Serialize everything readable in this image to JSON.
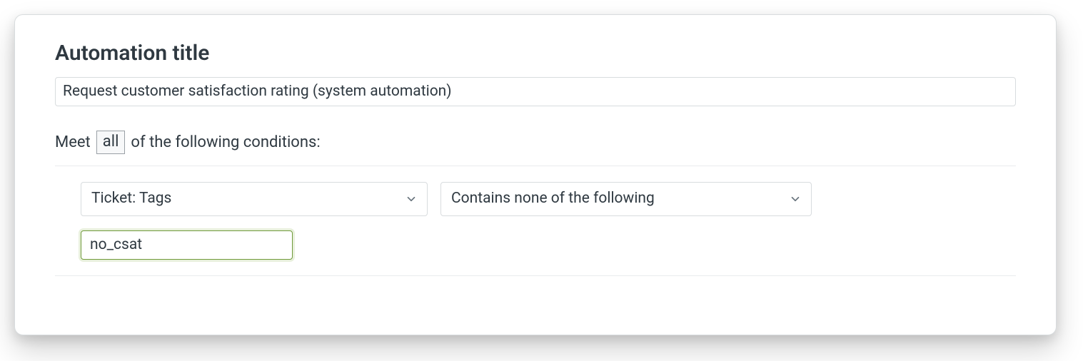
{
  "heading": "Automation title",
  "title_field": {
    "value": "Request customer satisfaction rating (system automation)"
  },
  "conditions": {
    "intro_prefix": "Meet",
    "quantifier": "all",
    "intro_suffix": "of the following conditions:",
    "rows": [
      {
        "field_select": "Ticket: Tags",
        "operator_select": "Contains none of the following",
        "tag_value": "no_csat"
      }
    ]
  }
}
